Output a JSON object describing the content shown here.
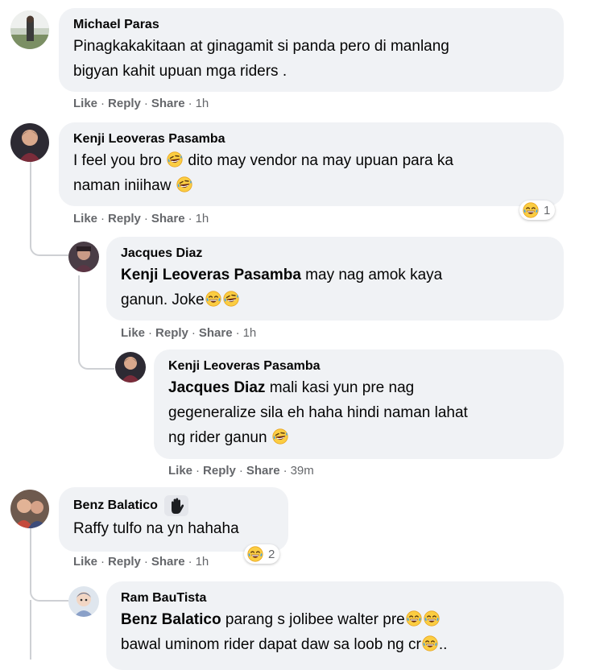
{
  "labels": {
    "like": "Like",
    "reply": "Reply",
    "share": "Share",
    "dot": "·"
  },
  "comments": [
    {
      "author": "Michael Paras",
      "lines": [
        "Pinagkakakitaan at ginagamit si panda pero di manlang",
        "bigyan kahit upuan mga riders ."
      ],
      "time": "1h"
    },
    {
      "author": "Kenji Leoveras Pasamba",
      "line1a": "I feel you bro",
      "line1b": "dito may vendor na may upuan para ka",
      "line2a": "naman iniihaw",
      "time": "1h",
      "reaction_count": "1"
    },
    {
      "author": "Jacques Diaz",
      "mention": "Kenji Leoveras Pasamba",
      "line1": "may nag amok kaya",
      "line2": "ganun. Joke",
      "time": "1h"
    },
    {
      "author": "Kenji Leoveras Pasamba",
      "mention": "Jacques Diaz",
      "line1": "mali kasi yun pre nag",
      "line2": "gegeneralize sila eh haha hindi naman lahat",
      "line3": "ng rider ganun",
      "time": "39m"
    },
    {
      "author": "Benz Balatico",
      "line1": "Raffy tulfo na yn hahaha",
      "time": "1h",
      "reaction_count": "2",
      "badge_icon": "top-fan-hand-icon"
    },
    {
      "author": "Ram BauTista",
      "mention": "Benz Balatico",
      "line1": "parang s jolibee walter pre",
      "line2": "bawal uminom rider dapat daw sa loob ng cr",
      "line2_end": ".."
    }
  ],
  "colors": {
    "bubble": "#f0f2f5",
    "meta": "#65676b",
    "text": "#050505",
    "emoji": "#fbcd42"
  }
}
